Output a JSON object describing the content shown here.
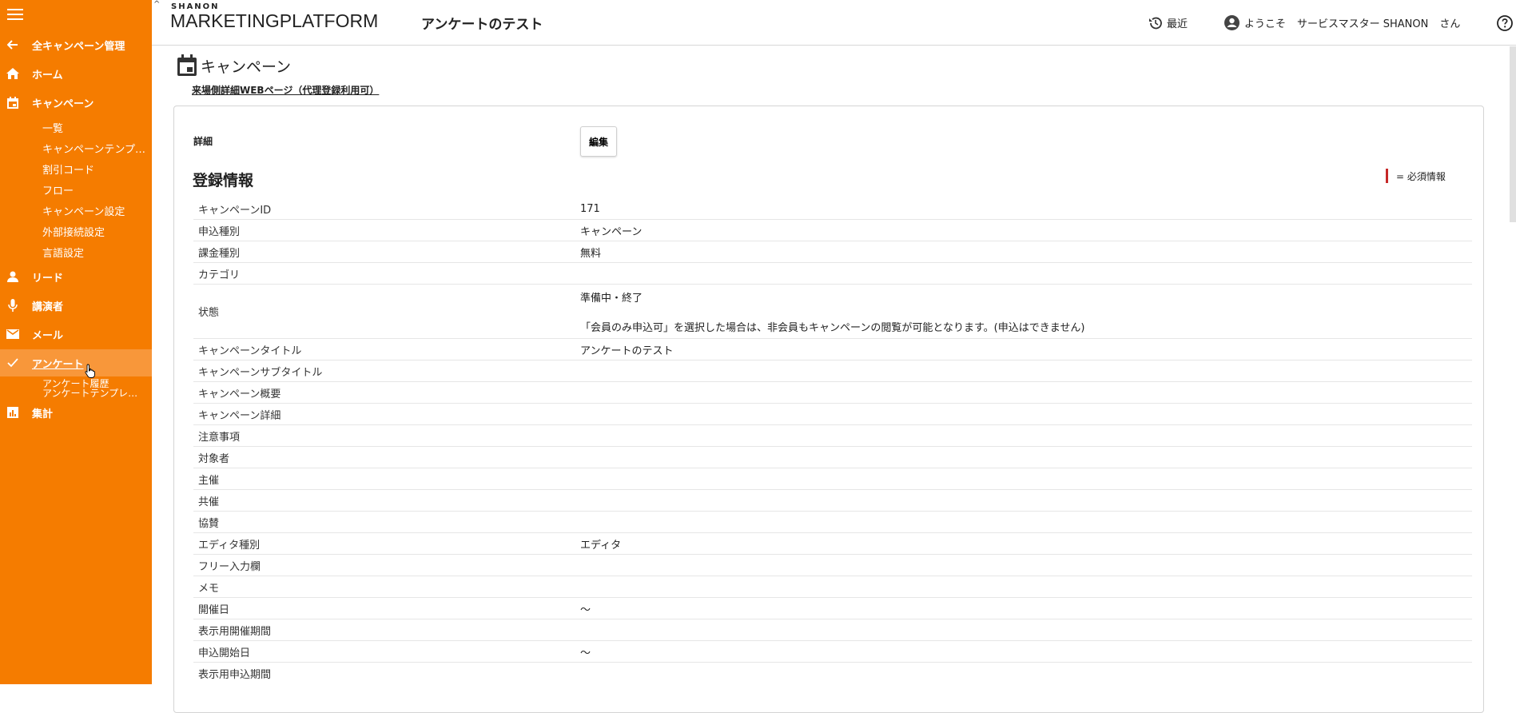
{
  "header": {
    "logo_small": "SHANON",
    "logo_big": "MARKETINGPLATFORM",
    "page_title": "アンケートのテスト",
    "recent_label": "最近",
    "welcome_label": "ようこそ",
    "user_name": "サービスマスター SHANON",
    "user_suffix": "さん"
  },
  "sidebar": {
    "back_label": "全キャンペーン管理",
    "home_label": "ホーム",
    "campaign_label": "キャンペーン",
    "campaign_sub": [
      "一覧",
      "キャンペーンテンプ…",
      "割引コード",
      "フロー",
      "キャンペーン設定",
      "外部接続設定",
      "言語設定"
    ],
    "lead_label": "リード",
    "speaker_label": "講演者",
    "mail_label": "メール",
    "survey_label": "アンケート",
    "survey_sub": [
      "アンケート履歴",
      "アンケートテンプレ…"
    ],
    "aggregate_label": "集計"
  },
  "main": {
    "section_title": "キャンペーン",
    "link_text": "来場側詳細WEBページ（代理登録利用可）",
    "detail_label": "詳細",
    "edit_button": "編集",
    "registration_title": "登録情報",
    "required_legend": "= 必須情報",
    "rows": [
      {
        "key": "キャンペーンID",
        "value": "171"
      },
      {
        "key": "申込種別",
        "value": "キャンペーン"
      },
      {
        "key": "課金種別",
        "value": "無料"
      },
      {
        "key": "カテゴリ",
        "value": ""
      },
      {
        "key": "状態",
        "value": "準備中・終了",
        "note": "「会員のみ申込可」を選択した場合は、非会員もキャンペーンの閲覧が可能となります。(申込はできません)"
      },
      {
        "key": "キャンペーンタイトル",
        "value": "アンケートのテスト"
      },
      {
        "key": "キャンペーンサブタイトル",
        "value": ""
      },
      {
        "key": "キャンペーン概要",
        "value": ""
      },
      {
        "key": "キャンペーン詳細",
        "value": ""
      },
      {
        "key": "注意事項",
        "value": ""
      },
      {
        "key": "対象者",
        "value": ""
      },
      {
        "key": "主催",
        "value": ""
      },
      {
        "key": "共催",
        "value": ""
      },
      {
        "key": "協賛",
        "value": ""
      },
      {
        "key": "エディタ種別",
        "value": "エディタ"
      },
      {
        "key": "フリー入力欄",
        "value": ""
      },
      {
        "key": "メモ",
        "value": ""
      },
      {
        "key": "開催日",
        "value": "～"
      },
      {
        "key": "表示用開催期間",
        "value": ""
      },
      {
        "key": "申込開始日",
        "value": "～"
      },
      {
        "key": "表示用申込期間",
        "value": ""
      }
    ]
  },
  "colors": {
    "sidebar_bg": "#f57c00",
    "sidebar_active": "#f8973a",
    "required_mark": "#c62828"
  }
}
